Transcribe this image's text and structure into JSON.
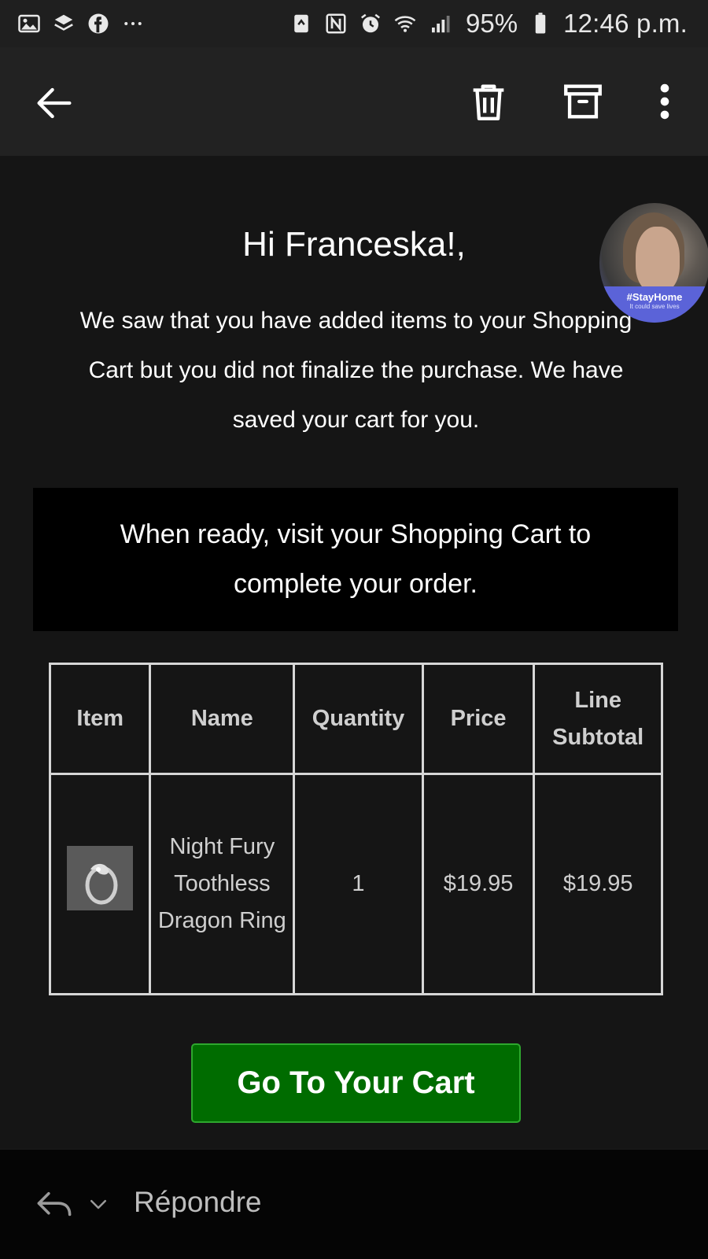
{
  "status_bar": {
    "left_icons": [
      "image-icon",
      "layers-icon",
      "facebook-icon",
      "more-dots-icon"
    ],
    "right_icons": [
      "recycle-icon",
      "nfc-icon",
      "alarm-icon",
      "wifi-icon",
      "signal-icon"
    ],
    "battery": "95%",
    "time": "12:46 p.m."
  },
  "app_bar": {
    "back_icon": "arrow-back-icon",
    "delete_icon": "trash-icon",
    "archive_icon": "archive-icon",
    "more_icon": "more-vertical-icon"
  },
  "email": {
    "greeting": "Hi Franceska!,",
    "intro": "We saw that you have added items to your Shopping Cart but you did not finalize the purchase. We have saved your cart for you.",
    "banner": "When ready, visit your Shopping Cart to complete your order.",
    "avatar": {
      "tag": "#StayHome",
      "sub": "It could save lives"
    },
    "table": {
      "headers": [
        "Item",
        "Name",
        "Quantity",
        "Price",
        "Line Subtotal"
      ],
      "rows": [
        {
          "item_image": "ring-thumbnail",
          "name": "Night Fury Toothless Dragon Ring",
          "quantity": "1",
          "price": "$19.95",
          "subtotal": "$19.95"
        }
      ]
    },
    "cta_label": "Go To Your Cart"
  },
  "bottom_bar": {
    "reply_label": "Répondre"
  },
  "colors": {
    "background": "#151515",
    "app_bar": "#222222",
    "banner": "#000000",
    "cta": "#006c00",
    "table_border": "#d6d6d6"
  }
}
